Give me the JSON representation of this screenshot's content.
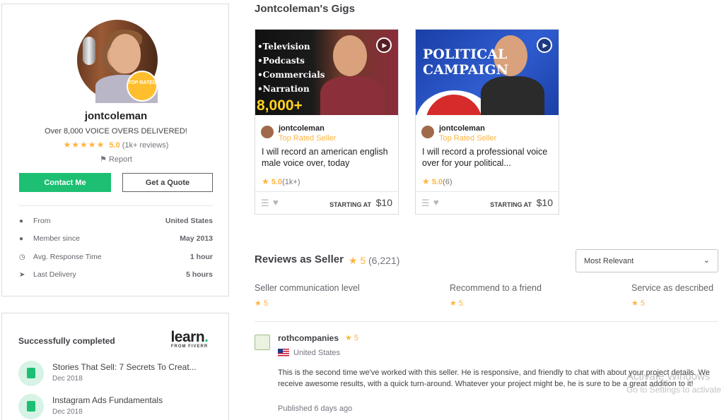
{
  "profile": {
    "username": "jontcoleman",
    "badge": "TOP RATED",
    "tagline": "Over 8,000 VOICE OVERS DELIVERED!",
    "stars": "★★★★★",
    "rating": "5.0",
    "review_count": "(1k+ reviews)",
    "report": "Report",
    "contact_label": "Contact Me",
    "quote_label": "Get a Quote",
    "stats": [
      {
        "label": "From",
        "value": "United States",
        "icon": "location-pin-icon"
      },
      {
        "label": "Member since",
        "value": "May 2013",
        "icon": "user-icon"
      },
      {
        "label": "Avg. Response Time",
        "value": "1 hour",
        "icon": "clock-icon"
      },
      {
        "label": "Last Delivery",
        "value": "5 hours",
        "icon": "paper-plane-icon"
      }
    ]
  },
  "learn": {
    "title": "Successfully completed",
    "logo": "learn",
    "logo_sub": "FROM FIVERR",
    "courses": [
      {
        "name": "Stories That Sell: 7 Secrets To Creat...",
        "date": "Dec 2018"
      },
      {
        "name": "Instagram Ads Fundamentals",
        "date": "Dec 2018"
      }
    ]
  },
  "gigs": {
    "title": "Jontcoleman's Gigs",
    "items": [
      {
        "image_bullets": [
          "•Television",
          "•Podcasts",
          "•Commercials",
          "•Narration"
        ],
        "image_headline": "8,000+",
        "seller": "jontcoleman",
        "level": "Top Rated Seller",
        "title": "I will record an american english male voice over, today",
        "rating": "5.0",
        "count": "(1k+)",
        "starting": "STARTING AT",
        "price": "$10"
      },
      {
        "image_headline": "POLITICAL CAMPAIGN",
        "seller": "jontcoleman",
        "level": "Top Rated Seller",
        "title": "I will record a professional voice over for your political...",
        "rating": "5.0",
        "count": "(6)",
        "starting": "STARTING AT",
        "price": "$10"
      }
    ]
  },
  "reviews": {
    "title": "Reviews as Seller",
    "score": "★ 5",
    "count": "(6,221)",
    "sort": "Most Relevant",
    "metrics": [
      {
        "label": "Seller communication level",
        "value": "★ 5"
      },
      {
        "label": "Recommend to a friend",
        "value": "★ 5"
      },
      {
        "label": "Service as described",
        "value": "★ 5"
      }
    ],
    "item": {
      "name": "rothcompanies",
      "score": "★ 5",
      "country": "United States",
      "text": "This is the second time we've worked with this seller. He is responsive, and friendly to chat with about your project details. We receive awesome results, with a quick turn-around. Whatever your project might be, he is sure to be a great addition to it!",
      "published": "Published 6 days ago"
    }
  },
  "watermark": {
    "line1": "Activate Windows",
    "line2": "Go to Settings to activate Windows."
  },
  "colors": {
    "brand_green": "#1dbf73",
    "star_yellow": "#ffb33e"
  }
}
